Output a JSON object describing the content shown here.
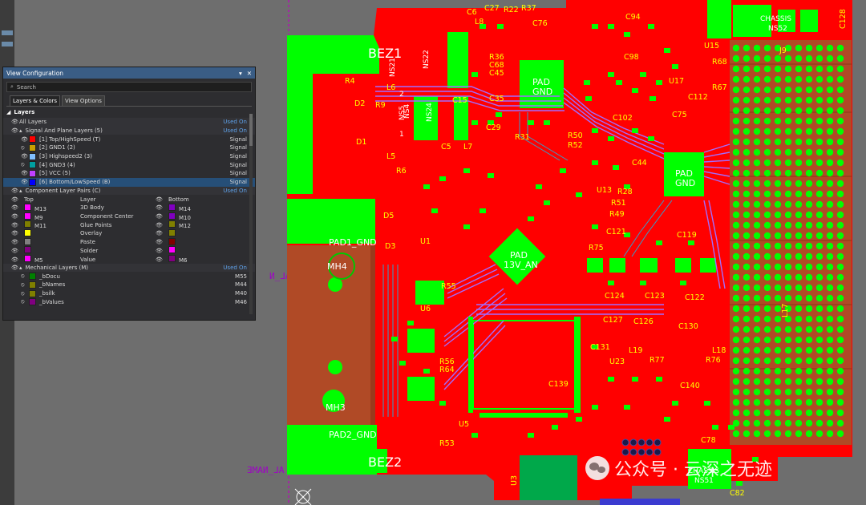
{
  "panel": {
    "title": "View Configuration",
    "search_placeholder": "Search",
    "tabs": [
      "Layers & Colors",
      "View Options"
    ],
    "section_layers": "Layers",
    "all_layers": {
      "label": "All Layers",
      "status": "Used On"
    },
    "signal_group": {
      "label": "Signal And Plane Layers (5)",
      "status": "Used On"
    },
    "signal_layers": [
      {
        "name": "[1] Top/HighSpeed (T)",
        "type": "Signal",
        "color": "#ff0000"
      },
      {
        "name": "[2] GND1 (2)",
        "type": "Signal",
        "color": "#c8a000"
      },
      {
        "name": "[3] Highspeed2 (3)",
        "type": "Signal",
        "color": "#80c0ff"
      },
      {
        "name": "[4] GND3 (4)",
        "type": "Signal",
        "color": "#00a0a0"
      },
      {
        "name": "[5] VCC (5)",
        "type": "Signal",
        "color": "#c040ff"
      },
      {
        "name": "[6] Bottom/LowSpeed (B)",
        "type": "Signal",
        "color": "#0000ff"
      }
    ],
    "component_group": {
      "label": "Component Layer Pairs (C)",
      "status": "Used On"
    },
    "component_header": {
      "top": "Top",
      "layer": "Layer",
      "bottom": "Bottom"
    },
    "component_pairs": [
      {
        "top": "M13",
        "layer": "3D Body",
        "bottom": "M14",
        "top_color": "#ff00ff",
        "bottom_color": "#8000c0"
      },
      {
        "top": "M9",
        "layer": "Component Center",
        "bottom": "M10",
        "top_color": "#ff00ff",
        "bottom_color": "#8000c0"
      },
      {
        "top": "M11",
        "layer": "Glue Points",
        "bottom": "M12",
        "top_color": "#808000",
        "bottom_color": "#808000"
      },
      {
        "top": "",
        "layer": "Overlay",
        "bottom": "",
        "top_color": "#ffff00",
        "bottom_color": "#808000"
      },
      {
        "top": "",
        "layer": "Paste",
        "bottom": "",
        "top_color": "#808080",
        "bottom_color": "#800000"
      },
      {
        "top": "",
        "layer": "Solder",
        "bottom": "",
        "top_color": "#800080",
        "bottom_color": "#ff00ff"
      },
      {
        "top": "M5",
        "layer": "Value",
        "bottom": "M6",
        "top_color": "#ff00ff",
        "bottom_color": "#800080"
      }
    ],
    "mech_group": {
      "label": "Mechanical Layers (M)",
      "status": "Used On"
    },
    "mech_layers": [
      {
        "name": "_bDocu",
        "code": "M55",
        "color": "#008000"
      },
      {
        "name": "_bNames",
        "code": "M44",
        "color": "#808000"
      },
      {
        "name": "_bsilk",
        "code": "M40",
        "color": "#808000"
      },
      {
        "name": "_bValues",
        "code": "M46",
        "color": "#800080"
      }
    ]
  },
  "pcb": {
    "labels": {
      "bez1": "BEZ1",
      "bez2": "BEZ2",
      "pad1_gnd": "PAD1_GND",
      "pad2_gnd": "PAD2_GND",
      "mh4": "MH4",
      "mh3": "MH3",
      "chassis_top": "CHASSIS",
      "ns52": "NS52",
      "chassis_bottom": "CHASSIS",
      "ns51": "NS51",
      "j9": "J9",
      "pad_gnd_1": "PAD",
      "pad_gnd_1b": "GND",
      "pad_gnd_2": "PAD",
      "pad_gnd_2b": "GND",
      "pad_13v_a": "PAD",
      "pad_13v_b": "13V_AN",
      "u1": "U1",
      "u3": "U3",
      "u5": "U5",
      "u6": "U6",
      "u23": "U23",
      "u13": "U13",
      "c5": "C5",
      "l7": "L7",
      "c6": "C6",
      "c27": "C27",
      "r22": "R22",
      "r37": "R37",
      "c94": "C94",
      "c98": "C98",
      "c102": "C102",
      "c75": "C75",
      "c44": "C44",
      "r28": "R28",
      "r49": "R49",
      "r51": "R51",
      "c121": "C121",
      "c119": "C119",
      "c124": "C124",
      "c123": "C123",
      "c122": "C122",
      "c127": "C127",
      "c126": "C126",
      "c130": "C130",
      "c131": "C131",
      "c139": "C139",
      "c140": "C140",
      "c78": "C78",
      "c82": "C82",
      "c128": "C128",
      "r77": "R77",
      "r76": "R76",
      "l18": "L18",
      "l19": "L19",
      "l17": "L17",
      "r53": "R53",
      "r55": "R55",
      "r56": "R56",
      "r64": "R64",
      "r75": "R75",
      "r50": "R50",
      "r52": "R52",
      "r31": "R31",
      "r36": "R36",
      "c68": "C68",
      "c45": "C45",
      "c35": "C35",
      "c15": "C15",
      "r4": "R4",
      "d2": "D2",
      "d1": "D1",
      "r9": "R9",
      "l6": "L6",
      "l5": "L5",
      "r6": "R6",
      "l8": "L8",
      "c29": "C29",
      "c76": "C76",
      "u15": "U15",
      "r68": "R68",
      "r67": "R67",
      "u17": "U17",
      "c112": "C112",
      "ns4": "NS4",
      "ns21": "NS21",
      "ns22": "NS22",
      "ns24": "NS24",
      "ns5": "NS5",
      "num1": "1",
      "num2": "2",
      "d5": "D5",
      "d3": "D3"
    }
  },
  "mirror_texts": {
    "t1": "NAL_N",
    "t2": "AL_NAME"
  },
  "watermark": {
    "text": "公众号 · 云深之无迹"
  },
  "colors": {
    "board_red": "#ff0000",
    "copper_green": "#00ff00",
    "silk_yellow": "#ffff00",
    "trace_purple": "#a26cff",
    "panel_header": "#3a5d85",
    "background": "#6e6e6e"
  }
}
